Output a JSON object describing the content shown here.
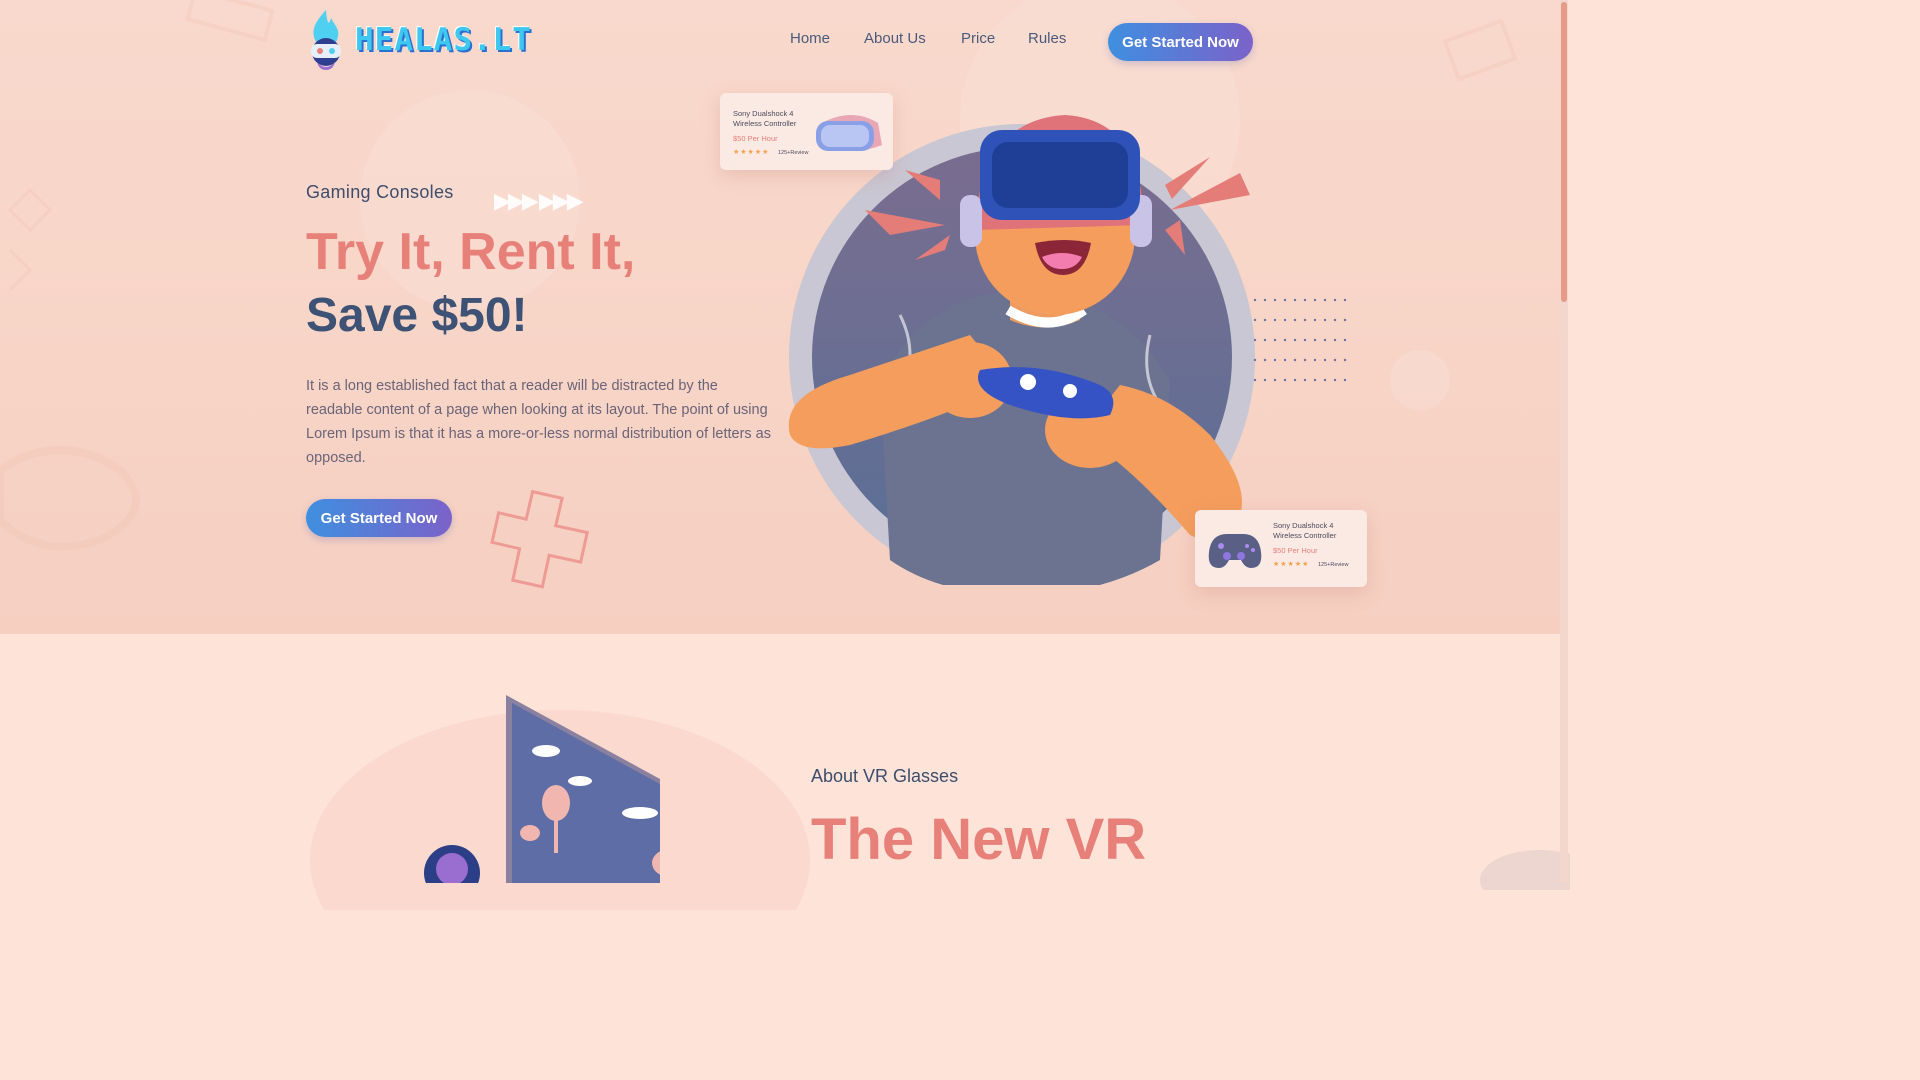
{
  "brand": {
    "name": "HEALAS.LT"
  },
  "nav": {
    "items": [
      "Home",
      "About Us",
      "Price",
      "Rules"
    ],
    "cta": "Get Started Now"
  },
  "hero": {
    "eyebrow": "Gaming Consoles",
    "title_line1": "Try It, Rent It,",
    "title_line2": "Save $50!",
    "description": "It is a long established fact that a reader will be distracted by the readable content of a page when looking at its layout. The point of using Lorem Ipsum is that it has a more-or-less normal distribution of letters as opposed.",
    "cta": "Get Started Now",
    "arrows": "▶▶▶  ▶▶▶"
  },
  "cards": [
    {
      "title": "Sony Dualshock 4 Wireless Controller",
      "price": "$50 Per Hour",
      "stars": "★★★★★",
      "reviews": "125+Review",
      "icon": "vr-headset-icon"
    },
    {
      "title": "Sony Dualshock 4 Wireless Controller",
      "price": "$50 Per Hour",
      "stars": "★★★★★",
      "reviews": "125+Review",
      "icon": "gamepad-icon"
    }
  ],
  "about": {
    "eyebrow": "About VR Glasses",
    "title": "The New VR"
  },
  "colors": {
    "accent": "#e8807a",
    "navy": "#3d5274",
    "button_start": "#3f8fe0",
    "button_end": "#7b62c9",
    "logo": "#3ec7ef"
  }
}
